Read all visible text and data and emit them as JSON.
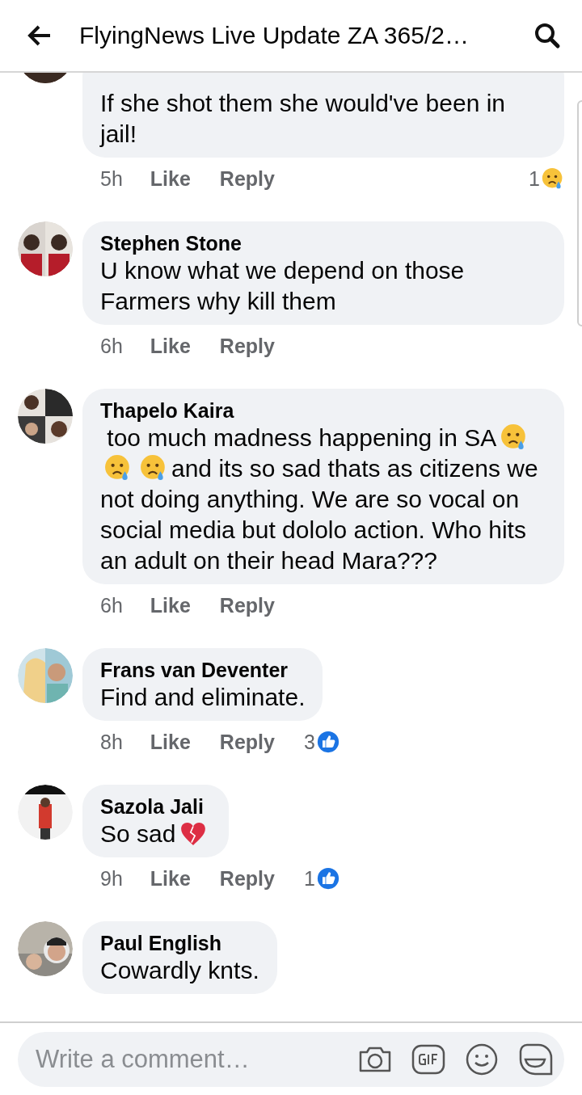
{
  "header": {
    "title": "FlyingNews Live Update ZA 365/2…"
  },
  "comments": [
    {
      "body": [
        [
          {
            "kind": "text",
            "text": "If she shot them she would've been in jail!"
          }
        ]
      ],
      "time": "5h",
      "like": "Like",
      "reply": "Reply",
      "reaction": {
        "kind": "sad",
        "count": "1"
      }
    },
    {
      "name": "Stephen Stone",
      "body": [
        [
          {
            "kind": "text",
            "text": "U know what we depend on those Farmers why kill them"
          }
        ]
      ],
      "time": "6h",
      "like": "Like",
      "reply": "Reply"
    },
    {
      "name": "Thapelo Kaira",
      "body": [
        [
          {
            "kind": "text",
            "text": " too much madness happening in SA"
          },
          {
            "kind": "sad"
          }
        ],
        [
          {
            "kind": "sad"
          },
          {
            "kind": "sad"
          },
          {
            "kind": "text",
            "text": "and its so sad thats as citizens we"
          }
        ],
        [
          {
            "kind": "text",
            "text": "not doing anything. We are so vocal on social media but dololo action. Who hits an adult on their head Mara???"
          }
        ]
      ],
      "time": "6h",
      "like": "Like",
      "reply": "Reply"
    },
    {
      "name": "Frans van Deventer",
      "body": [
        [
          {
            "kind": "text",
            "text": "Find and eliminate."
          }
        ]
      ],
      "time": "8h",
      "like": "Like",
      "reply": "Reply",
      "reaction": {
        "kind": "like",
        "count": "3"
      }
    },
    {
      "name": "Sazola Jali",
      "body": [
        [
          {
            "kind": "text",
            "text": "So sad"
          },
          {
            "kind": "broken-heart"
          }
        ]
      ],
      "time": "9h",
      "like": "Like",
      "reply": "Reply",
      "reaction": {
        "kind": "like",
        "count": "1"
      }
    },
    {
      "name": "Paul English",
      "body": [
        [
          {
            "kind": "text",
            "text": "Cowardly knts."
          }
        ]
      ]
    }
  ],
  "composer": {
    "placeholder": "Write a comment…"
  }
}
